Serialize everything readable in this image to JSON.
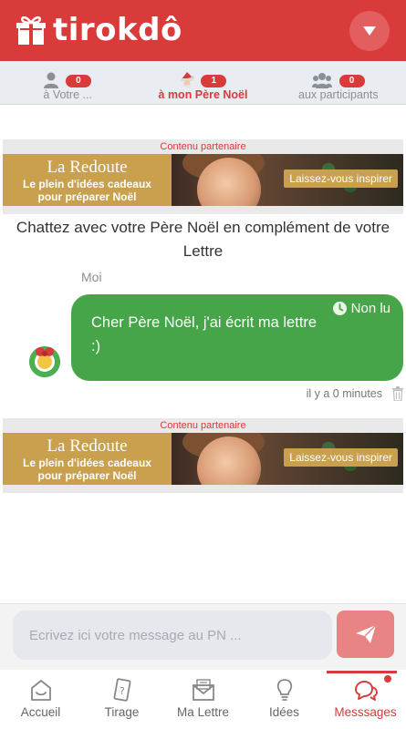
{
  "header": {
    "logo_text": "tirokdô",
    "menu_icon": "chevron-down-icon"
  },
  "tabs": [
    {
      "label": "à Votre ...",
      "badge": "0",
      "icon": "person-icon",
      "active": false
    },
    {
      "label": "à mon Père Noël",
      "badge": "1",
      "icon": "santa-icon",
      "active": true
    },
    {
      "label": "aux participants",
      "badge": "0",
      "icon": "group-icon",
      "active": false
    }
  ],
  "ad": {
    "label": "Contenu partenaire",
    "brand": "La Redoute",
    "tagline_1": "Le plein d'idées cadeaux",
    "tagline_2": "pour préparer Noël",
    "cta": "Laissez-vous inspirer"
  },
  "chat": {
    "intro": "Chattez avec votre Père Noël en complément de votre Lettre",
    "sender": "Moi",
    "message": "Cher Père Noël, j'ai écrit ma lettre :)",
    "status": "Non lu",
    "time": "il y a 0 minutes"
  },
  "composer": {
    "placeholder": "Ecrivez ici votre message au PN ..."
  },
  "bottom_nav": [
    {
      "label": "Accueil",
      "icon": "home-icon",
      "active": false
    },
    {
      "label": "Tirage",
      "icon": "draw-card-icon",
      "active": false
    },
    {
      "label": "Ma Lettre",
      "icon": "envelope-icon",
      "active": false
    },
    {
      "label": "Idées",
      "icon": "lightbulb-icon",
      "active": false
    },
    {
      "label": "Messsages",
      "icon": "chat-icon",
      "active": true
    }
  ],
  "colors": {
    "brand_red": "#d93a3a",
    "bubble_green": "#45a548",
    "send_button": "#e88484"
  }
}
